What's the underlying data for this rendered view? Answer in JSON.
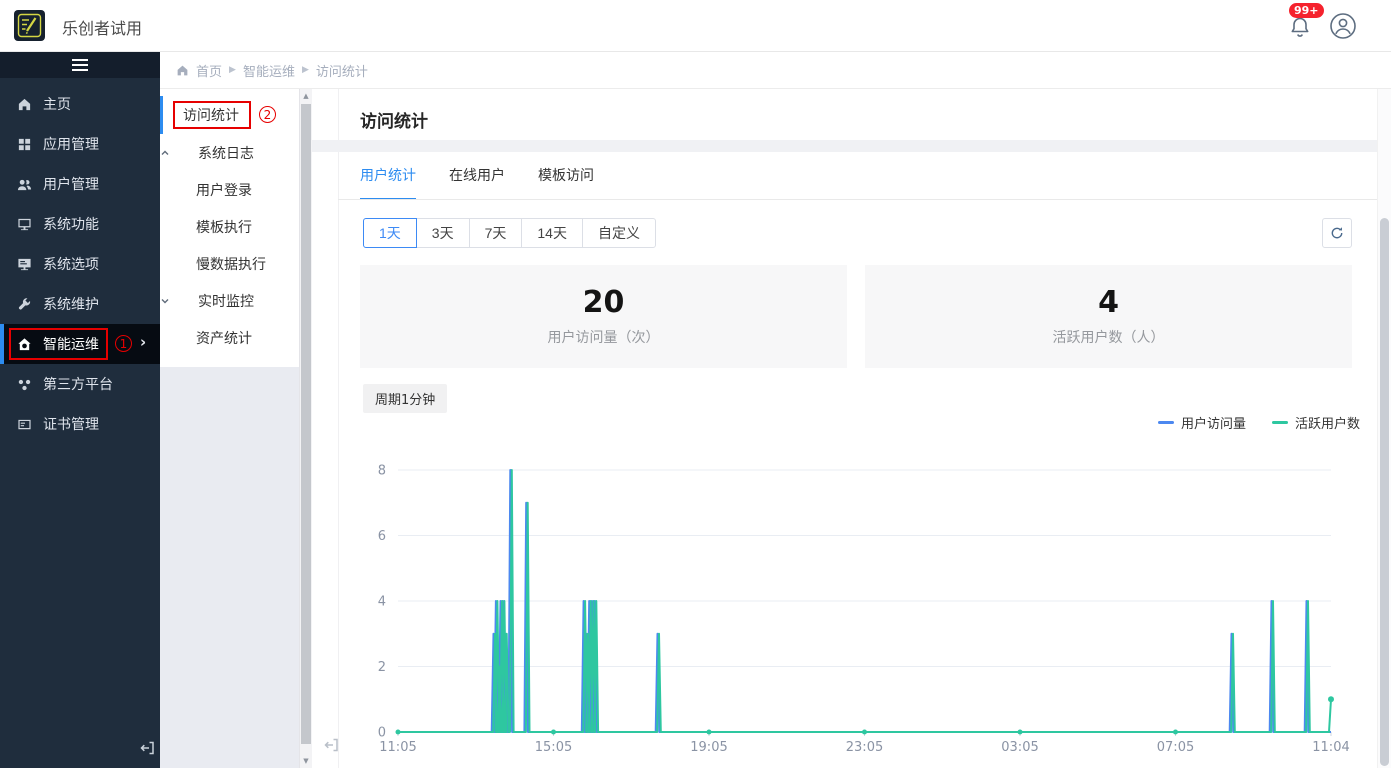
{
  "colors": {
    "accent_blue": "#2d8cf0",
    "series_blue": "#4C88F0",
    "series_teal": "#2EC7A0",
    "annotation_red": "#e60000",
    "badge_red": "#f5222d",
    "sidebar_bg": "#1f2d3d"
  },
  "header": {
    "app_title": "乐创者试用",
    "logo_icon": "pencil-logo-icon",
    "notification_badge": "99+"
  },
  "sidebar": {
    "menu_icon": "hamburger-icon",
    "exit_icon": "exit-icon",
    "items": [
      {
        "id": "home",
        "label": "主页",
        "icon": "home-icon"
      },
      {
        "id": "app-management",
        "label": "应用管理",
        "icon": "app-management-icon"
      },
      {
        "id": "user-management",
        "label": "用户管理",
        "icon": "user-management-icon"
      },
      {
        "id": "system-functions",
        "label": "系统功能",
        "icon": "system-functions-icon"
      },
      {
        "id": "system-options",
        "label": "系统选项",
        "icon": "system-options-icon"
      },
      {
        "id": "system-maintenance",
        "label": "系统维护",
        "icon": "system-maintenance-icon"
      },
      {
        "id": "intelligent-ops",
        "label": "智能运维",
        "icon": "intelligent-ops-icon",
        "active": true,
        "annotation": "①",
        "chevron": "›"
      },
      {
        "id": "third-party",
        "label": "第三方平台",
        "icon": "third-party-icon"
      },
      {
        "id": "certificate",
        "label": "证书管理",
        "icon": "certificate-icon"
      }
    ]
  },
  "submenu": {
    "items": [
      {
        "id": "access-stats",
        "label": "访问统计",
        "type": "leaf",
        "active": true,
        "annotation": "②"
      },
      {
        "id": "system-logs",
        "label": "系统日志",
        "type": "group",
        "caret": "up"
      },
      {
        "id": "user-login",
        "label": "用户登录",
        "type": "child"
      },
      {
        "id": "template-exec",
        "label": "模板执行",
        "type": "child"
      },
      {
        "id": "slow-data-exec",
        "label": "慢数据执行",
        "type": "child"
      },
      {
        "id": "realtime-monitor",
        "label": "实时监控",
        "type": "group",
        "caret": "down"
      },
      {
        "id": "asset-stats",
        "label": "资产统计",
        "type": "child"
      }
    ]
  },
  "breadcrumb": {
    "home_icon": "home-icon",
    "items": [
      "首页",
      "智能运维",
      "访问统计"
    ],
    "separator": "▶"
  },
  "page": {
    "title": "访问统计"
  },
  "tabs": [
    {
      "id": "user-stats",
      "label": "用户统计",
      "active": true
    },
    {
      "id": "online-users",
      "label": "在线用户"
    },
    {
      "id": "template-access",
      "label": "模板访问"
    }
  ],
  "range_buttons": [
    {
      "label": "1天",
      "active": true
    },
    {
      "label": "3天"
    },
    {
      "label": "7天"
    },
    {
      "label": "14天"
    },
    {
      "label": "自定义"
    }
  ],
  "refresh_icon": "refresh-icon",
  "stats": [
    {
      "value": "20",
      "label": "用户访问量（次）"
    },
    {
      "value": "4",
      "label": "活跃用户数（人）"
    }
  ],
  "period_badge": "周期1分钟",
  "chart_data": {
    "type": "line",
    "title": "",
    "x_axis": {
      "tick_labels": [
        "11:05",
        "15:05",
        "19:05",
        "23:05",
        "03:05",
        "07:05",
        "11:04"
      ],
      "window": "24 hours, 1-minute period",
      "note": "t values below are fractions of the full 24h x-range"
    },
    "y_axis": {
      "ticks": [
        0,
        2,
        4,
        6,
        8
      ],
      "range": [
        0,
        8
      ]
    },
    "grid": true,
    "legend_position": "top-right",
    "legend": [
      {
        "name": "用户访问量",
        "color": "#4C88F0"
      },
      {
        "name": "活跃用户数",
        "color": "#2EC7A0"
      }
    ],
    "series": [
      {
        "name": "用户访问量",
        "color": "#4C88F0",
        "baseline": 0,
        "note": "almost completely overlapped by the 活跃用户数 line",
        "spikes": [
          {
            "t": 0.104,
            "time": "13:35",
            "v": 3
          },
          {
            "t": 0.1065,
            "time": "13:39",
            "v": 4
          },
          {
            "t": 0.109,
            "time": "13:42",
            "v": 2
          },
          {
            "t": 0.1115,
            "time": "13:46",
            "v": 4
          },
          {
            "t": 0.114,
            "time": "13:49",
            "v": 4
          },
          {
            "t": 0.1165,
            "time": "13:53",
            "v": 3
          },
          {
            "t": 0.122,
            "time": "14:01",
            "v": 8
          },
          {
            "t": 0.139,
            "time": "14:25",
            "v": 7
          },
          {
            "t": 0.2005,
            "time": "15:53",
            "v": 4
          },
          {
            "t": 0.2035,
            "time": "15:58",
            "v": 3
          },
          {
            "t": 0.2065,
            "time": "16:02",
            "v": 4
          },
          {
            "t": 0.2095,
            "time": "16:06",
            "v": 4
          },
          {
            "t": 0.2125,
            "time": "16:11",
            "v": 4
          },
          {
            "t": 0.2797,
            "time": "17:48",
            "v": 3
          },
          {
            "t": 0.895,
            "time": "08:33",
            "v": 3
          },
          {
            "t": 0.9378,
            "time": "09:35",
            "v": 4
          },
          {
            "t": 0.9753,
            "time": "10:29",
            "v": 4
          }
        ]
      },
      {
        "name": "活跃用户数",
        "color": "#2EC7A0",
        "baseline": 0,
        "spikes": [
          {
            "t": 0.104,
            "time": "13:35",
            "v": 3
          },
          {
            "t": 0.1065,
            "time": "13:39",
            "v": 4
          },
          {
            "t": 0.109,
            "time": "13:42",
            "v": 2
          },
          {
            "t": 0.1115,
            "time": "13:46",
            "v": 4
          },
          {
            "t": 0.114,
            "time": "13:49",
            "v": 4
          },
          {
            "t": 0.1165,
            "time": "13:53",
            "v": 3
          },
          {
            "t": 0.122,
            "time": "14:01",
            "v": 8
          },
          {
            "t": 0.139,
            "time": "14:25",
            "v": 7
          },
          {
            "t": 0.2005,
            "time": "15:53",
            "v": 4
          },
          {
            "t": 0.2035,
            "time": "15:58",
            "v": 3
          },
          {
            "t": 0.2065,
            "time": "16:02",
            "v": 4
          },
          {
            "t": 0.2095,
            "time": "16:06",
            "v": 4
          },
          {
            "t": 0.2125,
            "time": "16:11",
            "v": 4
          },
          {
            "t": 0.2797,
            "time": "17:48",
            "v": 3
          },
          {
            "t": 0.895,
            "time": "08:33",
            "v": 3
          },
          {
            "t": 0.9378,
            "time": "09:35",
            "v": 4
          },
          {
            "t": 0.9753,
            "time": "10:29",
            "v": 4
          }
        ],
        "end_point": {
          "time": "11:04",
          "v": 1
        }
      }
    ]
  }
}
